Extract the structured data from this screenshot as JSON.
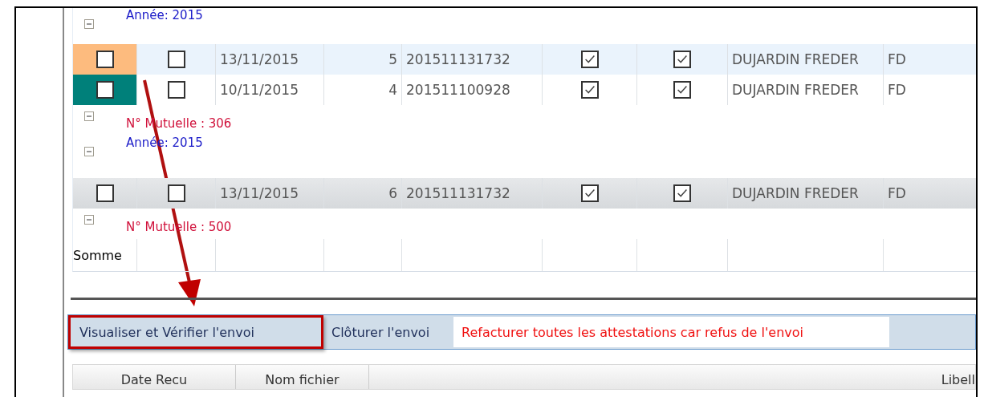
{
  "grid": {
    "rows": [
      {
        "kind": "year_group",
        "label": "Année: 2015",
        "expanded": true,
        "children": [
          {
            "kind": "record",
            "color": "#fdbb7e",
            "highlighted": true,
            "selected": false,
            "check_1": false,
            "check_2": false,
            "date": "13/11/2015",
            "number": "5",
            "file_id": "201511131732",
            "check_3": true,
            "check_4": true,
            "name": "DUJARDIN FREDER",
            "initials": "FD"
          },
          {
            "kind": "record",
            "color": "#00807a",
            "highlighted": false,
            "selected": false,
            "check_1": false,
            "check_2": false,
            "date": "10/11/2015",
            "number": "4",
            "file_id": "201511100928",
            "check_3": true,
            "check_4": true,
            "name": "DUJARDIN FREDER",
            "initials": "FD"
          }
        ]
      },
      {
        "kind": "mutuelle_group",
        "label": "N° Mutuelle : 306",
        "expanded": true,
        "children": []
      },
      {
        "kind": "year_group",
        "label": "Année: 2015",
        "expanded": true,
        "children": [
          {
            "kind": "record",
            "highlighted": false,
            "selected": true,
            "check_1": false,
            "check_2": false,
            "date": "13/11/2015",
            "number": "6",
            "file_id": "201511131732",
            "check_3": true,
            "check_4": true,
            "name": "DUJARDIN FREDER",
            "initials": "FD"
          }
        ]
      },
      {
        "kind": "mutuelle_group",
        "label": "N° Mutuelle : 500",
        "expanded": true,
        "children": []
      }
    ],
    "footer": "Somme"
  },
  "actions": [
    {
      "kind": "tab",
      "label": "Visualiser et Vérifier l'envoi",
      "highlighted": true
    },
    {
      "kind": "tab",
      "label": "Clôturer l'envoi",
      "highlighted": false
    },
    {
      "kind": "warning",
      "label": "Refacturer toutes les attestations car refus de l'envoi",
      "highlighted": false
    }
  ],
  "files_table": {
    "columns": [
      "Date Recu",
      "Nom fichier",
      "Libell"
    ]
  }
}
